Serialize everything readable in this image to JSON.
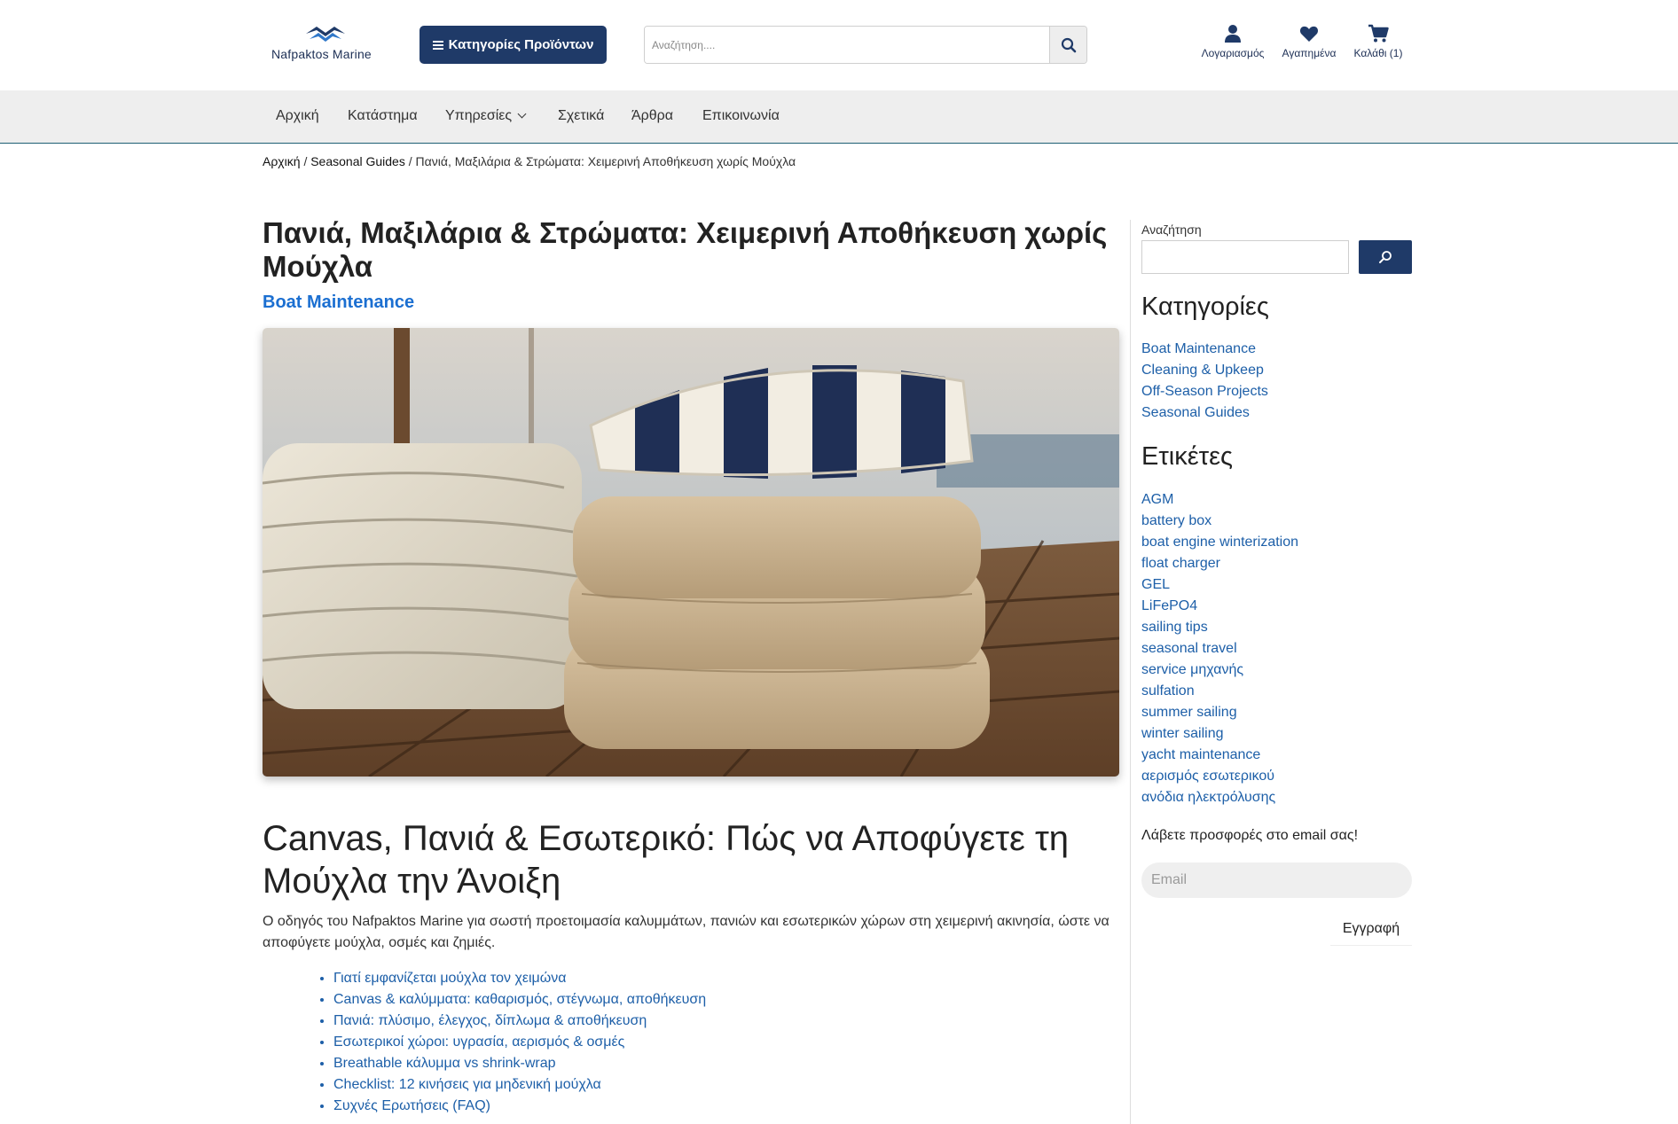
{
  "header": {
    "logo_text": "Nafpaktos Marine",
    "categories_button": "Κατηγορίες Προϊόντων",
    "search_placeholder": "Αναζήτηση....",
    "account_label": "Λογαριασμός",
    "favorites_label": "Αγαπημένα",
    "cart_label": "Καλάθι (1)",
    "brand_color": "#1f3a68"
  },
  "nav": {
    "items": [
      "Αρχική",
      "Κατάστημα",
      "Υπηρεσίες",
      "Σχετικά",
      "Άρθρα",
      "Επικοινωνία"
    ]
  },
  "breadcrumb": {
    "home": "Αρχική",
    "section": "Seasonal Guides",
    "current": "Πανιά, Μαξιλάρια & Στρώματα: Χειμερινή Αποθήκευση χωρίς Μούχλα"
  },
  "post": {
    "title": "Πανιά, Μαξιλάρια & Στρώματα: Χειμερινή Αποθήκευση χωρίς Μούχλα",
    "category": "Boat Maintenance",
    "h2": "Canvas, Πανιά & Εσωτερικό: Πώς να Αποφύγετε τη Μούχλα την Άνοιξη",
    "intro": "Ο οδηγός του Nafpaktos Marine για σωστή προετοιμασία καλυμμάτων, πανιών και εσωτερικών χώρων στη χειμερινή ακινησία, ώστε να αποφύγετε μούχλα, οσμές και ζημιές.",
    "toc": [
      "Γιατί εμφανίζεται μούχλα τον χειμώνα",
      "Canvas & καλύμματα: καθαρισμός, στέγνωμα, αποθήκευση",
      "Πανιά: πλύσιμο, έλεγχος, δίπλωμα & αποθήκευση",
      "Εσωτερικοί χώροι: υγρασία, αερισμός & οσμές",
      "Breathable κάλυμμα vs shrink-wrap",
      "Checklist: 12 κινήσεις για μηδενική μούχλα",
      "Συχνές Ερωτήσεις (FAQ)"
    ]
  },
  "sidebar": {
    "search_label": "Αναζήτηση",
    "categories_heading": "Κατηγορίες",
    "categories": [
      "Boat Maintenance",
      "Cleaning & Upkeep",
      "Off-Season Projects",
      "Seasonal Guides"
    ],
    "tags_heading": "Ετικέτες",
    "tags": [
      "AGM",
      "battery box",
      "boat engine winterization",
      "float charger",
      "GEL",
      "LiFePO4",
      "sailing tips",
      "seasonal travel",
      "service μηχανής",
      "sulfation",
      "summer sailing",
      "winter sailing",
      "yacht maintenance",
      "αερισμός εσωτερικού",
      "ανόδια ηλεκτρόλυσης"
    ],
    "newsletter_label": "Λάβετε προσφορές στο email σας!",
    "email_placeholder": "Email",
    "subscribe_button": "Εγγραφή"
  }
}
